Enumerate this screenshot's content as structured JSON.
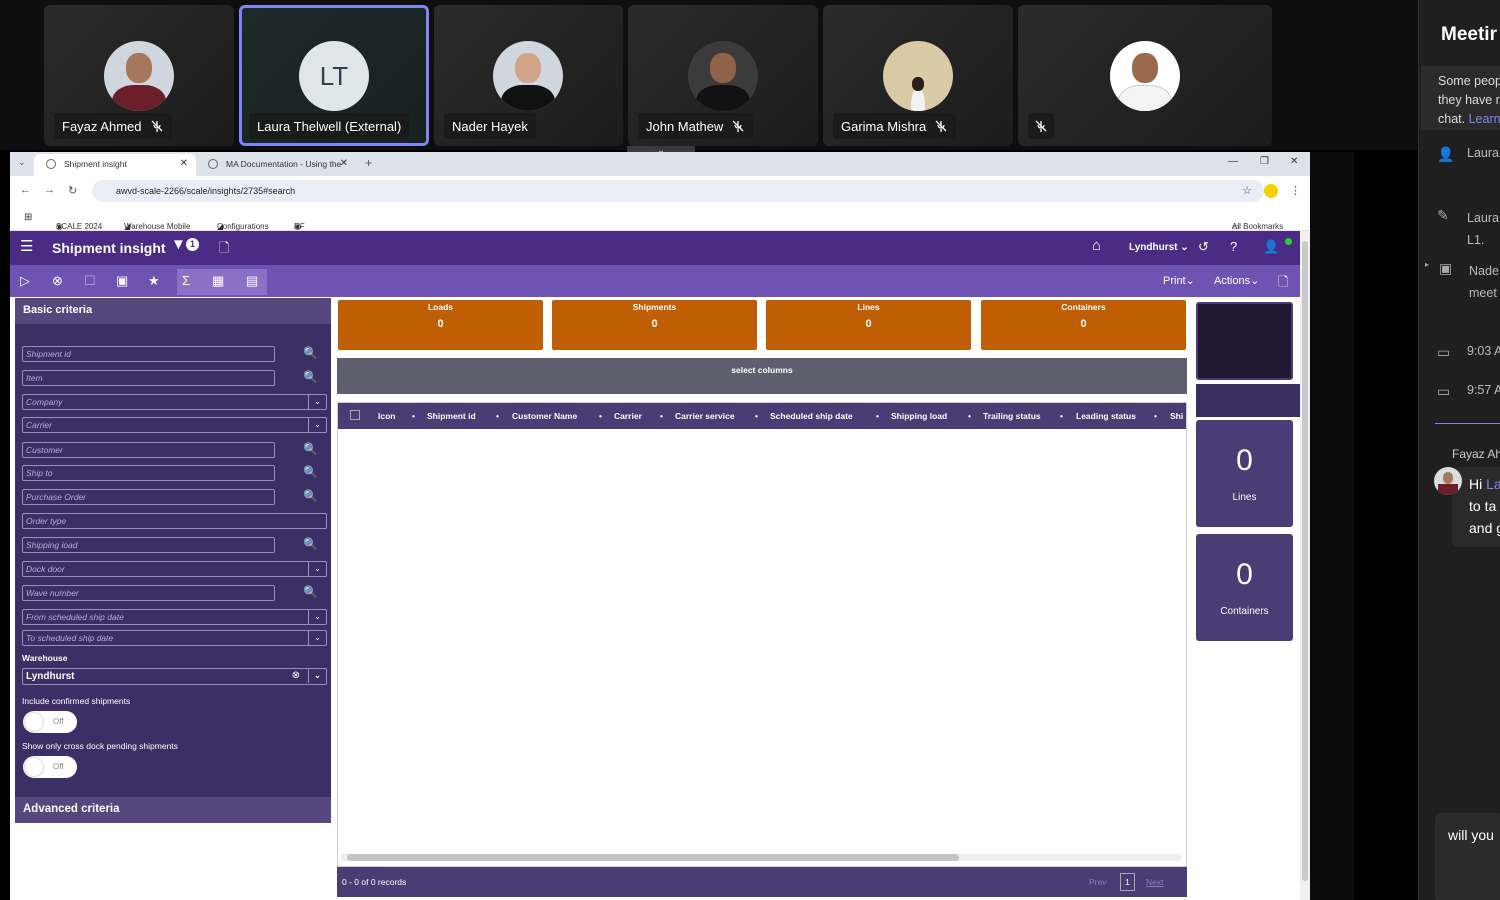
{
  "participants": [
    {
      "name": "Fayaz Ahmed",
      "muted": true
    },
    {
      "name": "Laura Thelwell (External)",
      "initials": "LT",
      "muted": false
    },
    {
      "name": "Nader Hayek",
      "muted": false
    },
    {
      "name": "John Mathew",
      "muted": true
    },
    {
      "name": "Garima Mishra",
      "muted": true
    },
    {
      "name": "",
      "muted": true
    }
  ],
  "teams": {
    "title": "Meetir",
    "notice": [
      "Some peop",
      "they have r",
      "chat."
    ],
    "notice_link": "Learn",
    "events": [
      {
        "icon": "person-add-icon",
        "l1": "Laura",
        "l2": ""
      },
      {
        "icon": "pencil-icon",
        "l1": "Laura",
        "l2": "L1."
      },
      {
        "icon": "meeting-icon",
        "l1": "Nade",
        "l2": "meet"
      },
      {
        "icon": "video-icon",
        "l1": "9:03 A",
        "l2": ""
      },
      {
        "icon": "video-icon",
        "l1": "9:57 A",
        "l2": ""
      }
    ],
    "chat_name": "Fayaz Ah",
    "chat_lines": [
      "Hi",
      "to ta",
      "and g"
    ],
    "chat_mention": "La",
    "compose": "will you"
  },
  "browser": {
    "tabs": [
      "Shipment insight",
      "MA Documentation - Using the"
    ],
    "url": "awvd-scale-2266/scale/insights/2735#search",
    "bookmarks": [
      "SCALE 2024",
      "Warehouse Mobile",
      "Configurations",
      "RF"
    ],
    "all_bookmarks": "All Bookmarks"
  },
  "app": {
    "title": "Shipment insight",
    "filter_badge": "1",
    "warehouse_menu": "Lyndhurst",
    "print": "Print",
    "actions": "Actions"
  },
  "criteria": {
    "header": "Basic criteria",
    "fields": [
      {
        "ph": "Shipment id",
        "kind": "search"
      },
      {
        "ph": "Item",
        "kind": "search"
      },
      {
        "ph": "Company",
        "kind": "dropdown"
      },
      {
        "ph": "Carrier",
        "kind": "dropdown"
      },
      {
        "ph": "Customer",
        "kind": "search"
      },
      {
        "ph": "Ship to",
        "kind": "search"
      },
      {
        "ph": "Purchase Order",
        "kind": "search"
      },
      {
        "ph": "Order type",
        "kind": "text"
      },
      {
        "ph": "Shipping load",
        "kind": "search"
      },
      {
        "ph": "Dock door",
        "kind": "dropdown"
      },
      {
        "ph": "Wave number",
        "kind": "search"
      },
      {
        "ph": "From scheduled ship date",
        "kind": "dropdown"
      },
      {
        "ph": "To scheduled ship date",
        "kind": "dropdown"
      }
    ],
    "warehouse_label": "Warehouse",
    "warehouse_value": "Lyndhurst",
    "toggle1_label": "Include confirmed shipments",
    "toggle2_label": "Show only cross dock pending shipments",
    "toggle_off": "Off",
    "advanced": "Advanced criteria"
  },
  "kpis": [
    {
      "label": "Loads",
      "value": "0"
    },
    {
      "label": "Shipments",
      "value": "0"
    },
    {
      "label": "Lines",
      "value": "0"
    },
    {
      "label": "Containers",
      "value": "0"
    }
  ],
  "select_columns": "select columns",
  "grid": {
    "columns": [
      "Icon",
      "Shipment id",
      "Customer Name",
      "Carrier",
      "Carrier service",
      "Scheduled ship date",
      "Shipping load",
      "Trailing status",
      "Leading status",
      "Shi"
    ],
    "records": "0 - 0 of 0 records",
    "prev": "Prev",
    "page": "1",
    "next": "Next"
  },
  "side_cards": [
    {
      "value": "0",
      "label": "Lines"
    },
    {
      "value": "0",
      "label": "Containers"
    }
  ]
}
